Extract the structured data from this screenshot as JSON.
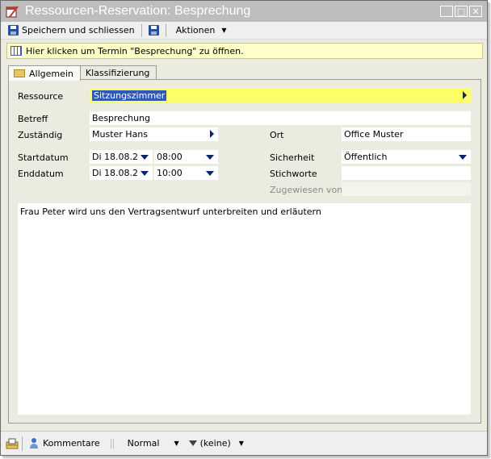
{
  "window": {
    "title": "Ressourcen-Reservation: Besprechung",
    "buttons": {
      "minimize": "_",
      "maximize": "□",
      "close": "✕"
    }
  },
  "toolbar": {
    "save_close_label": "Speichern und schliessen",
    "actions_label": "Aktionen"
  },
  "infobar": {
    "text": "Hier klicken um Termin \"Besprechung\" zu öffnen."
  },
  "tabs": [
    {
      "label": "Allgemein",
      "active": true
    },
    {
      "label": "Klassifizierung",
      "active": false
    }
  ],
  "form": {
    "ressource": {
      "label": "Ressource",
      "value": "Sitzungszimmer"
    },
    "betreff": {
      "label": "Betreff",
      "value": "Besprechung"
    },
    "zustaendig": {
      "label": "Zuständig",
      "value": "Muster Hans"
    },
    "ort": {
      "label": "Ort",
      "value": "Office Muster"
    },
    "startdatum": {
      "label": "Startdatum",
      "date": "Di 18.08.2",
      "time": "08:00"
    },
    "enddatum": {
      "label": "Enddatum",
      "date": "Di 18.08.2",
      "time": "10:00"
    },
    "sicherheit": {
      "label": "Sicherheit",
      "value": "Öffentlich"
    },
    "stichworte": {
      "label": "Stichworte",
      "value": ""
    },
    "zugewiesen_von": {
      "label": "Zugewiesen von",
      "value": ""
    },
    "notes": "Frau Peter wird uns den Vertragsentwurf unterbreiten und erläutern"
  },
  "statusbar": {
    "comments_label": "Kommentare",
    "priority_value": "Normal",
    "filter_value": "(keine)"
  },
  "colors": {
    "accent": "#2f58b8",
    "highlight_field": "#ffff66",
    "infobar_bg": "#ffffc8",
    "titlebar_bg": "#bdbdbd"
  }
}
